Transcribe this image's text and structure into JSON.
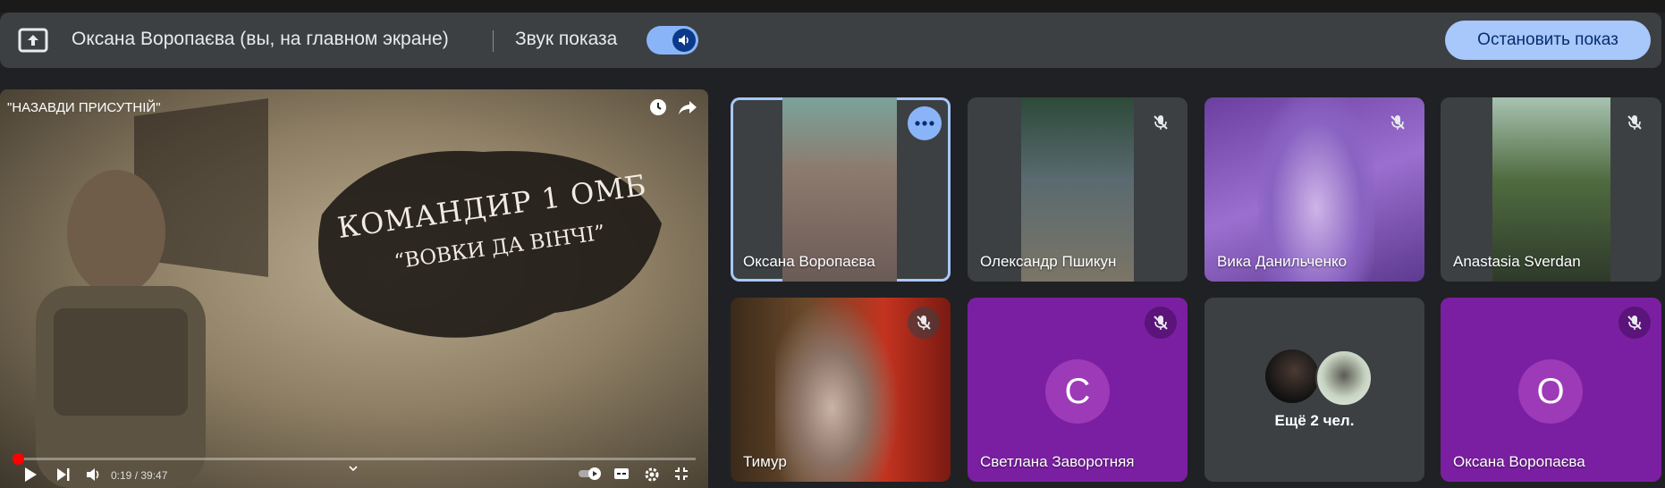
{
  "presenting_bar": {
    "title": "Оксана Воропаєва (вы, на главном экране)",
    "sound_label": "Звук показа",
    "stop_button": "Остановить показ",
    "accent": "#a8c7fa"
  },
  "video": {
    "title": "\"НАЗАВДИ ПРИСУТНІЙ\"",
    "overlay_title": "КОМАНДИР 1 ОМБ",
    "overlay_subtitle": "“ВОВКИ ДА ВІНЧІ”",
    "time": "0:19 / 39:47",
    "progress": 0.008
  },
  "participants": [
    {
      "name": "Оксана Воропаєва",
      "mic": "more-options"
    },
    {
      "name": "Олександр Пшикун",
      "mic": "muted"
    },
    {
      "name": "Вика Данильченко",
      "mic": "muted"
    },
    {
      "name": "Anastasia Sverdan",
      "mic": "muted"
    },
    {
      "name": "Тимур",
      "mic": "muted"
    },
    {
      "name": "Светлана Заворотняя",
      "mic": "muted",
      "initial": "С"
    },
    {
      "name": "Ещё 2 чел.",
      "mic": "none"
    },
    {
      "name": "Оксана Воропаєва",
      "mic": "muted",
      "initial": "О"
    }
  ]
}
